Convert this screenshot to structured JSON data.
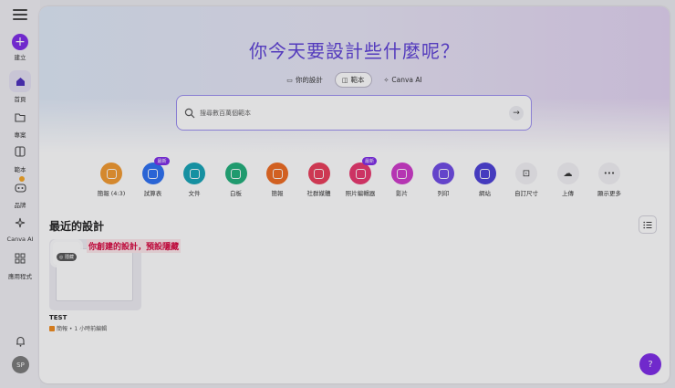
{
  "sidebar": {
    "items": [
      {
        "label": "建立",
        "icon": "plus-icon"
      },
      {
        "label": "首頁",
        "icon": "home-icon"
      },
      {
        "label": "專案",
        "icon": "folder-icon"
      },
      {
        "label": "範本",
        "icon": "template-icon"
      },
      {
        "label": "品牌",
        "icon": "brand-icon"
      },
      {
        "label": "Canva AI",
        "icon": "sparkle-icon"
      },
      {
        "label": "應用程式",
        "icon": "apps-icon"
      }
    ],
    "avatar_initials": "SP"
  },
  "hero": {
    "title": "你今天要設計些什麼呢？",
    "tabs": [
      "你的設計",
      "範本",
      "Canva AI"
    ]
  },
  "search": {
    "placeholder": "搜尋數百萬個範本"
  },
  "categories": [
    {
      "label": "簡報 (4:3)",
      "color": "#f2992e",
      "badge": ""
    },
    {
      "label": "試算表",
      "color": "#2b6ff2",
      "badge": "最新"
    },
    {
      "label": "文件",
      "color": "#13a3b5",
      "badge": ""
    },
    {
      "label": "白板",
      "color": "#1fae7a",
      "badge": ""
    },
    {
      "label": "簡報",
      "color": "#ef6a1f",
      "badge": ""
    },
    {
      "label": "社群媒體",
      "color": "#ea3b59",
      "badge": ""
    },
    {
      "label": "照片編輯器",
      "color": "#e9356d",
      "badge": "最新"
    },
    {
      "label": "影片",
      "color": "#ce38c9",
      "badge": ""
    },
    {
      "label": "列印",
      "color": "#6e49e6",
      "badge": ""
    },
    {
      "label": "網站",
      "color": "#4a3fd8",
      "badge": ""
    },
    {
      "label": "自訂尺寸",
      "color": "#ffffff",
      "badge": ""
    },
    {
      "label": "上傳",
      "color": "#ffffff",
      "badge": ""
    },
    {
      "label": "顯示更多",
      "color": "#ffffff",
      "badge": ""
    }
  ],
  "recent": {
    "title": "最近的設計",
    "hidden_tag": "隱藏",
    "annotation": "你創建的設計，預設隱藏",
    "design_name": "TEST",
    "design_meta": "簡報 • 1 小時前編輯"
  },
  "help_label": "?"
}
